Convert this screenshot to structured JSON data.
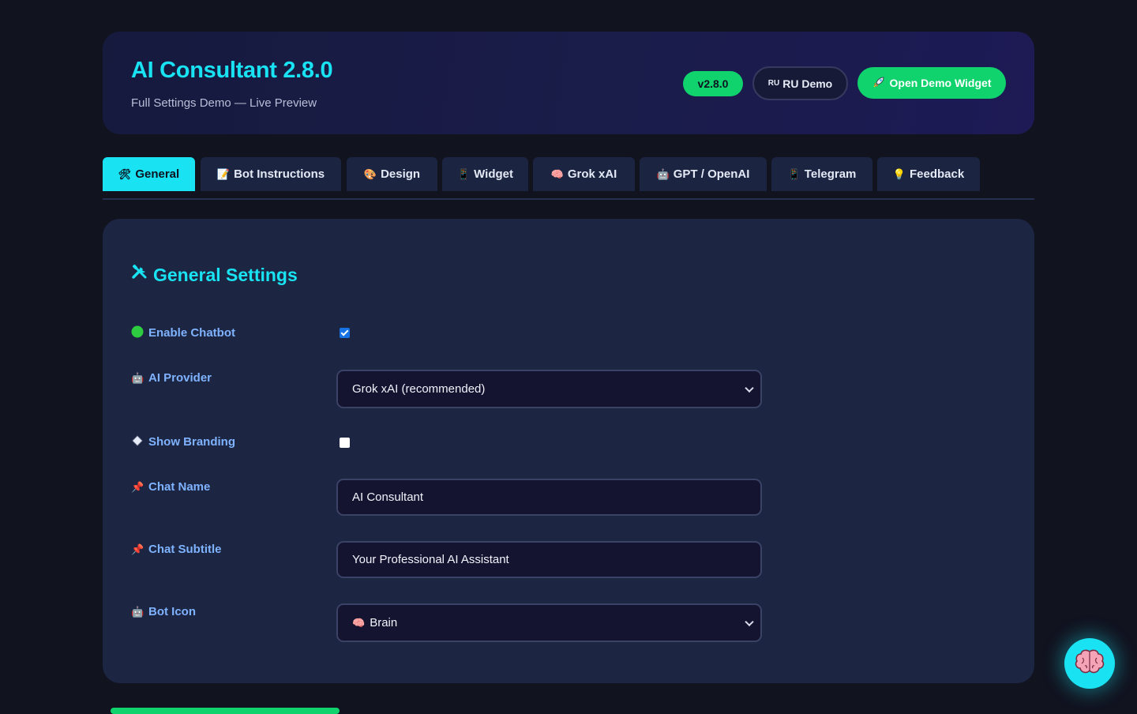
{
  "header": {
    "title": "AI Consultant 2.8.0",
    "subtitle": "Full Settings Demo — Live Preview",
    "version_badge": "v2.8.0",
    "ru_demo": {
      "flag": "RU",
      "label": "RU Demo"
    },
    "open_demo": {
      "icon": "rocket-icon",
      "label": "Open Demo Widget"
    }
  },
  "tabs": [
    {
      "label": "General",
      "icon": "tools-icon",
      "active": true
    },
    {
      "label": "Bot Instructions",
      "icon": "memo-icon"
    },
    {
      "label": "Design",
      "icon": "palette-icon"
    },
    {
      "label": "Widget",
      "icon": "phone-icon"
    },
    {
      "label": "Grok xAI",
      "icon": "brain-icon"
    },
    {
      "label": "GPT / OpenAI",
      "icon": "robot-icon"
    },
    {
      "label": "Telegram",
      "icon": "phone-icon"
    },
    {
      "label": "Feedback",
      "icon": "lightbulb-icon"
    }
  ],
  "panel": {
    "title": "General Settings",
    "rows": {
      "enable_chatbot": {
        "label": "Enable Chatbot",
        "checked": true
      },
      "ai_provider": {
        "label": "AI Provider",
        "value": "Grok xAI (recommended)"
      },
      "show_branding": {
        "label": "Show Branding",
        "checked": false
      },
      "chat_name": {
        "label": "Chat Name",
        "value": "AI Consultant"
      },
      "chat_subtitle": {
        "label": "Chat Subtitle",
        "value": "Your Professional AI Assistant"
      },
      "bot_icon": {
        "label": "Bot Icon",
        "value": "Brain",
        "value_icon": "brain-icon"
      }
    }
  },
  "colors": {
    "accent": "#19e3f2",
    "success": "#10d36e",
    "label": "#7fb3ff",
    "panel": "#1c2541",
    "background": "#11131f"
  }
}
